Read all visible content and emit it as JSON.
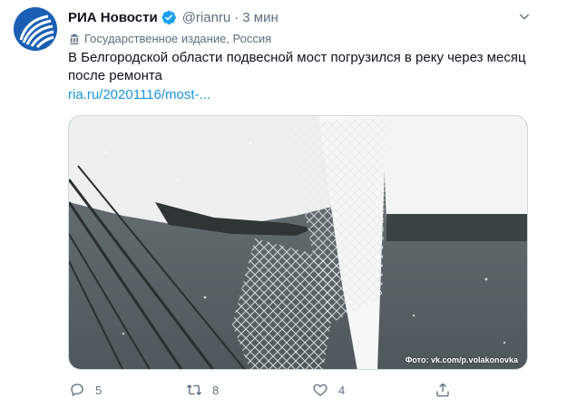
{
  "tweet": {
    "author_name": "РИА Новости",
    "handle": "@rianru",
    "separator": "·",
    "time": "3 мин",
    "account_label": "Государственное издание, Россия",
    "text": "В Белгородской области подвесной мост погрузился в реку через месяц после ремонта",
    "link": "ria.ru/20201116/most-...",
    "media_credit": "Фото: vk.com/p.volakonovka"
  },
  "actions": {
    "replies": "5",
    "retweets": "8",
    "likes": "4"
  },
  "colors": {
    "text_primary": "#0f1419",
    "text_secondary": "#5b7083",
    "link": "#1b95e0",
    "verified": "#1da1f2",
    "avatar_bg": "#1a5fb4"
  },
  "icons": [
    "ria-logo-avatar",
    "verified-badge-icon",
    "chevron-down-icon",
    "state-media-flag-icon",
    "reply-icon",
    "retweet-icon",
    "like-icon",
    "share-icon"
  ]
}
